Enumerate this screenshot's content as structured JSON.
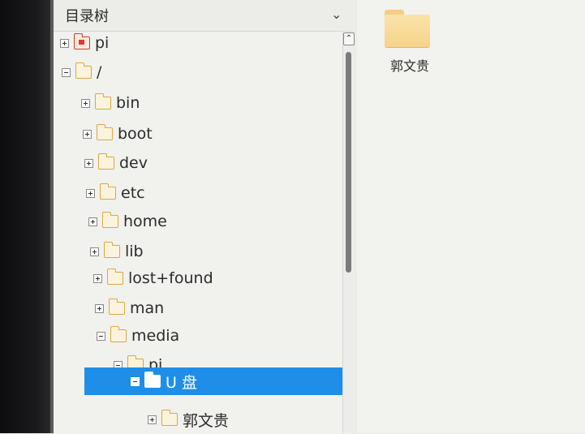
{
  "panel": {
    "title": "目录树",
    "collapse_icon": "chevron-down-icon"
  },
  "tree": [
    {
      "label": "pi",
      "toggle": "plus",
      "icon": "home-folder-icon"
    },
    {
      "label": "/",
      "toggle": "minus",
      "icon": "folder-icon"
    },
    {
      "label": "bin",
      "toggle": "plus",
      "icon": "folder-icon"
    },
    {
      "label": "boot",
      "toggle": "plus",
      "icon": "folder-icon"
    },
    {
      "label": "dev",
      "toggle": "plus",
      "icon": "folder-icon"
    },
    {
      "label": "etc",
      "toggle": "plus",
      "icon": "folder-icon"
    },
    {
      "label": "home",
      "toggle": "plus",
      "icon": "folder-icon"
    },
    {
      "label": "lib",
      "toggle": "plus",
      "icon": "folder-icon"
    },
    {
      "label": "lost+found",
      "toggle": "plus",
      "icon": "folder-icon"
    },
    {
      "label": "man",
      "toggle": "plus",
      "icon": "folder-icon"
    },
    {
      "label": "media",
      "toggle": "minus",
      "icon": "folder-icon"
    },
    {
      "label": "pi",
      "toggle": "minus",
      "icon": "folder-icon"
    },
    {
      "label": "U 盘",
      "toggle": "minus",
      "icon": "folder-icon",
      "selected": true
    },
    {
      "label": "郭文贵",
      "toggle": "plus",
      "icon": "folder-icon"
    }
  ],
  "content": {
    "items": [
      {
        "label": "郭文贵",
        "icon": "folder-icon"
      }
    ]
  },
  "colors": {
    "selection": "#1e8ee8",
    "folder_outline": "#d9a844"
  }
}
